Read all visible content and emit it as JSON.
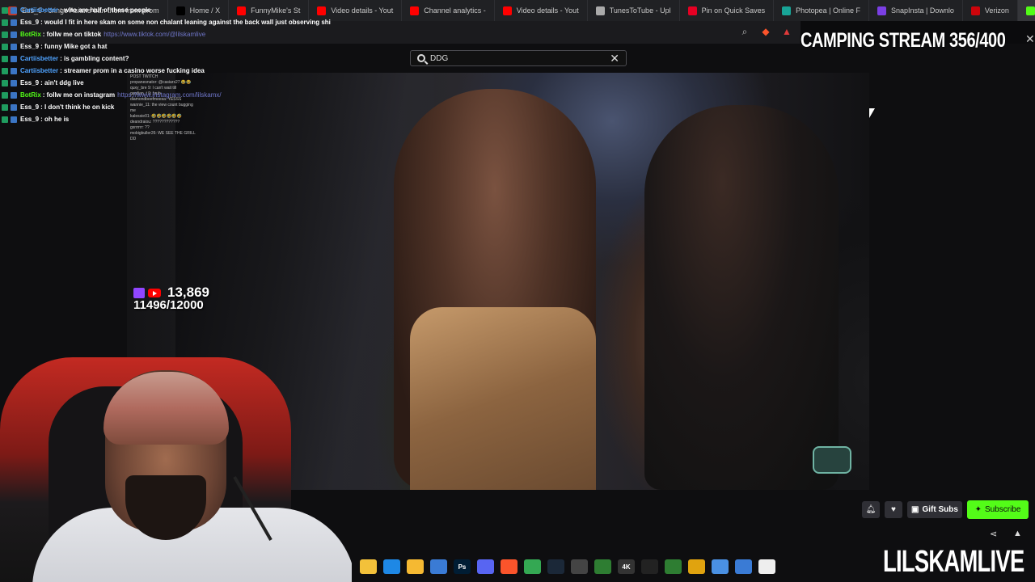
{
  "browser": {
    "tabs": [
      {
        "label": "Ess_9 : cringe Asians ban them from prom",
        "color": "#c0392b"
      },
      {
        "label": "Home / X",
        "color": "#000000"
      },
      {
        "label": "FunnyMike's St",
        "color": "#ff0000"
      },
      {
        "label": "Video details - Yout",
        "color": "#ff0000"
      },
      {
        "label": "Channel analytics -",
        "color": "#ff0000"
      },
      {
        "label": "Video details - Yout",
        "color": "#ff0000"
      },
      {
        "label": "TunesToTube - Upl",
        "color": "#aaaaaa"
      },
      {
        "label": "Pin on Quick Saves",
        "color": "#e60023"
      },
      {
        "label": "Photopea | Online F",
        "color": "#18a497"
      },
      {
        "label": "SnapInsta | Downlo",
        "color": "#7b3fe4"
      },
      {
        "label": "Verizon",
        "color": "#cd040b"
      },
      {
        "label": "DDG",
        "color": "#53fc18"
      }
    ]
  },
  "chat": {
    "messages": [
      {
        "user": "Cartiisbetter",
        "user_color": "#4fa3ff",
        "text": ": who are half of these people",
        "link": ""
      },
      {
        "user": "Ess_9",
        "user_color": "#ffffff",
        "text": ": would I fit in here skam on some non chalant leaning against the back wall just observing shi",
        "link": ""
      },
      {
        "user": "BotRix",
        "user_color": "#53fc18",
        "text": ": follw me on tiktok",
        "link": "https://www.tiktok.com/@lilskamlive"
      },
      {
        "user": "Ess_9",
        "user_color": "#ffffff",
        "text": ": funny Mike got a hat",
        "link": ""
      },
      {
        "user": "Cartiisbetter",
        "user_color": "#4fa3ff",
        "text": ": is gambling content?",
        "link": ""
      },
      {
        "user": "Cartiisbetter",
        "user_color": "#4fa3ff",
        "text": ": streamer prom in a casino worse fucking idea",
        "link": ""
      },
      {
        "user": "Ess_9",
        "user_color": "#ffffff",
        "text": ": ain't ddg live",
        "link": ""
      },
      {
        "user": "BotRix",
        "user_color": "#53fc18",
        "text": ": follw me on instagram",
        "link": "https://www.instagram.com/lilskamx/"
      },
      {
        "user": "Ess_9",
        "user_color": "#ffffff",
        "text": ": I don't think he on kick",
        "link": ""
      },
      {
        "user": "Ess_9",
        "user_color": "#ffffff",
        "text": ": oh he is",
        "link": ""
      }
    ]
  },
  "search": {
    "value": "DDG"
  },
  "overlay": {
    "title": "CAMPING STREAM 356/400",
    "viewers": "13,869",
    "goal": "11496/12000",
    "brand": "LILSKAMLIVE"
  },
  "video_chat": {
    "lines": [
      "POST TWITCH",
      "propanesnator: @casiarx27 😂😂",
      "quxy_bre 9: I can't wait till",
      "gardian_t 9: bruh",
      "diamondbeefmeesa: YESSS",
      "wannie_11: the view count bugging",
      "me",
      "kalessie01: 🤣🤣🤣🤣🤣🤣",
      "deandraiou: ????????????",
      "gxrrrrrr: ??",
      "mobigbuller26: WE SEE THE GRILL",
      "DD"
    ]
  },
  "actions": {
    "gift_label": "Gift Subs",
    "subscribe_label": "Subscribe",
    "accent": "#53fc18"
  },
  "taskbar": {
    "apps": [
      {
        "name": "explorer-icon",
        "color": "#f3c13a",
        "label": ""
      },
      {
        "name": "edge-icon",
        "color": "#1e88e5",
        "label": ""
      },
      {
        "name": "folder-icon",
        "color": "#f5b932",
        "label": ""
      },
      {
        "name": "store-icon",
        "color": "#3a7bd5",
        "label": ""
      },
      {
        "name": "photoshop-icon",
        "color": "#001d34",
        "label": "Ps"
      },
      {
        "name": "discord-icon",
        "color": "#5865f2",
        "label": ""
      },
      {
        "name": "brave-icon",
        "color": "#fb542b",
        "label": ""
      },
      {
        "name": "chrome-icon",
        "color": "#34a853",
        "label": ""
      },
      {
        "name": "steam-icon",
        "color": "#1b2838",
        "label": ""
      },
      {
        "name": "app-icon",
        "color": "#444444",
        "label": ""
      },
      {
        "name": "app2-icon",
        "color": "#2e7d32",
        "label": ""
      },
      {
        "name": "4k-icon",
        "color": "#333333",
        "label": "4K"
      },
      {
        "name": "app3-icon",
        "color": "#222222",
        "label": ""
      },
      {
        "name": "app4-icon",
        "color": "#2e7d32",
        "label": ""
      },
      {
        "name": "app5-icon",
        "color": "#e0a30f",
        "label": ""
      },
      {
        "name": "doc-icon",
        "color": "#4a90e2",
        "label": ""
      },
      {
        "name": "app6-icon",
        "color": "#3a7bd5",
        "label": ""
      },
      {
        "name": "file-icon",
        "color": "#eeeeee",
        "label": ""
      }
    ]
  }
}
